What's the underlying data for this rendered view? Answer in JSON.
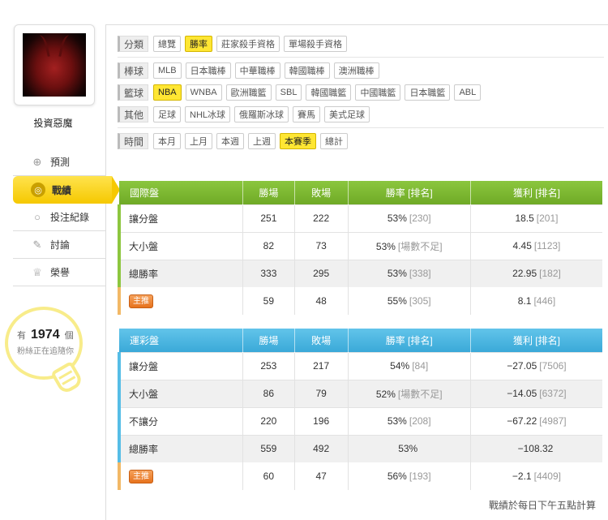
{
  "sidebar": {
    "username": "投資惡魔",
    "menu": [
      {
        "label": "預測",
        "icon": "target-icon",
        "active": false
      },
      {
        "label": "戰績",
        "icon": "trophy-swirl-icon",
        "active": true
      },
      {
        "label": "投注紀錄",
        "icon": "record-icon",
        "active": false
      },
      {
        "label": "討論",
        "icon": "discussion-icon",
        "active": false
      },
      {
        "label": "榮譽",
        "icon": "medal-icon",
        "active": false
      }
    ],
    "fans": {
      "prefix": "有",
      "count": "1974",
      "suffix": "個",
      "line2": "粉絲正在追隨你"
    }
  },
  "filters": {
    "category": {
      "label": "分類",
      "options": [
        "總覽",
        "勝率",
        "莊家殺手資格",
        "單場殺手資格"
      ],
      "selected": "勝率"
    },
    "baseball": {
      "label": "棒球",
      "options": [
        "MLB",
        "日本職棒",
        "中華職棒",
        "韓國職棒",
        "澳洲職棒"
      ]
    },
    "basketball": {
      "label": "籃球",
      "options": [
        "NBA",
        "WNBA",
        "歐洲職籃",
        "SBL",
        "韓國職籃",
        "中國職籃",
        "日本職籃",
        "ABL"
      ],
      "selected": "NBA"
    },
    "other": {
      "label": "其他",
      "options": [
        "足球",
        "NHL冰球",
        "俄羅斯冰球",
        "賽馬",
        "美式足球"
      ]
    },
    "time": {
      "label": "時間",
      "options": [
        "本月",
        "上月",
        "本週",
        "上週",
        "本賽季",
        "總計"
      ],
      "selected": "本賽季"
    }
  },
  "intl_table": {
    "headers": [
      "國際盤",
      "勝場",
      "敗場",
      "勝率 [排名]",
      "獲利 [排名]"
    ],
    "rows": [
      {
        "name": "讓分盤",
        "win": "251",
        "lose": "222",
        "rate": "53%",
        "rate_rank": "[230]",
        "profit": "18.5",
        "profit_rank": "[201]"
      },
      {
        "name": "大小盤",
        "win": "82",
        "lose": "73",
        "rate": "53%",
        "rate_rank": "[場數不足]",
        "profit": "4.45",
        "profit_rank": "[1123]"
      },
      {
        "name": "總勝率",
        "win": "333",
        "lose": "295",
        "rate": "53%",
        "rate_rank": "[338]",
        "profit": "22.95",
        "profit_rank": "[182]"
      }
    ],
    "special": {
      "badge": "主推",
      "win": "59",
      "lose": "48",
      "rate": "55%",
      "rate_rank": "[305]",
      "profit": "8.1",
      "profit_rank": "[446]"
    }
  },
  "lottery_table": {
    "headers": [
      "運彩盤",
      "勝場",
      "敗場",
      "勝率 [排名]",
      "獲利 [排名]"
    ],
    "rows": [
      {
        "name": "讓分盤",
        "win": "253",
        "lose": "217",
        "rate": "54%",
        "rate_rank": "[84]",
        "profit": "−27.05",
        "profit_rank": "[7506]"
      },
      {
        "name": "大小盤",
        "win": "86",
        "lose": "79",
        "rate": "52%",
        "rate_rank": "[場數不足]",
        "profit": "−14.05",
        "profit_rank": "[6372]"
      },
      {
        "name": "不讓分",
        "win": "220",
        "lose": "196",
        "rate": "53%",
        "rate_rank": "[208]",
        "profit": "−67.22",
        "profit_rank": "[4987]"
      },
      {
        "name": "總勝率",
        "win": "559",
        "lose": "492",
        "rate": "53%",
        "rate_rank": "",
        "profit": "−108.32",
        "profit_rank": ""
      }
    ],
    "special": {
      "badge": "主推",
      "win": "60",
      "lose": "47",
      "rate": "56%",
      "rate_rank": "[193]",
      "profit": "−2.1",
      "profit_rank": "[4409]"
    }
  },
  "footer_note": "戰績於每日下午五點計算",
  "colors": {
    "accent_yellow": "#ffe633",
    "intl_green": "#7ab62f",
    "lottery_blue": "#4cb4e0",
    "badge_orange": "#e7721d"
  }
}
